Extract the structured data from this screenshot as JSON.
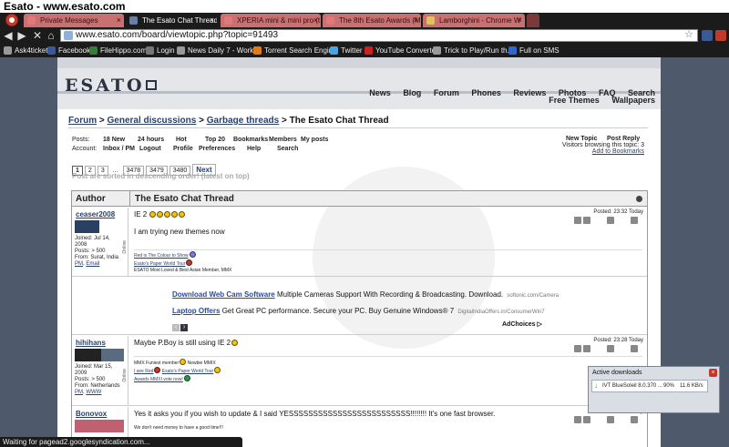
{
  "window": {
    "title": "Esato - www.esato.com"
  },
  "tabs": [
    {
      "label": "Private Messages",
      "color": "#e07a7a"
    },
    {
      "label": "The Esato Chat Thread",
      "color": "#6a7fa0"
    },
    {
      "label": "XPERIA mini & mini pro (t",
      "color": "#e07a7a"
    },
    {
      "label": "The 8th Esato Awards (M",
      "color": "#e07a7a"
    },
    {
      "label": "Lamborghini - Chrome W",
      "color": "#e0c060"
    }
  ],
  "address": {
    "url": "www.esato.com/board/viewtopic.php?topic=91493"
  },
  "bookmarks": [
    {
      "label": "Ask4ticket",
      "color": "#999999"
    },
    {
      "label": "Facebook",
      "color": "#3b5998"
    },
    {
      "label": "FileHippo.com",
      "color": "#3a7a3a"
    },
    {
      "label": "Login",
      "color": "#777777"
    },
    {
      "label": "News Daily 7 - Work...",
      "color": "#999999"
    },
    {
      "label": "Torrent Search Engine",
      "color": "#e07a1a"
    },
    {
      "label": "Twitter",
      "color": "#4aa3df"
    },
    {
      "label": "YouTube Converter",
      "color": "#cc2222"
    },
    {
      "label": "Trick to Play/Run th...",
      "color": "#999999"
    },
    {
      "label": "Full on SMS",
      "color": "#3366cc"
    }
  ],
  "site": {
    "logo": "ESATO",
    "nav": [
      "News",
      "Blog",
      "Forum",
      "Phones",
      "Reviews",
      "Photos",
      "FAQ",
      "Search"
    ],
    "nav2": [
      "Free Themes",
      "Wallpapers"
    ]
  },
  "breadcrumb": {
    "forum": "Forum",
    "general": "General discussions",
    "garbage": "Garbage threads",
    "current": "The Esato Chat Thread",
    "sep": " > "
  },
  "toolbar": {
    "posts_label": "Posts:",
    "posts": [
      "18 New",
      "24 hours",
      "Hot",
      "Top 20",
      "Bookmarks",
      "Members",
      "My posts"
    ],
    "account_label": "Account:",
    "account": [
      "Inbox / PM",
      "Logout",
      "Profile",
      "Preferences",
      "Help",
      "Search"
    ],
    "new_topic": "New Topic",
    "post_reply": "Post Reply",
    "visitors": "Visitors browsing this topic: 3",
    "add_bookmark": "Add to Bookmarks"
  },
  "pager": {
    "pages": [
      "1",
      "2",
      "3",
      "...",
      "3478",
      "3479",
      "3480"
    ],
    "next": "Next",
    "note": "Post are sorted in descending order! (latest on top)"
  },
  "thread": {
    "col_author": "Author",
    "col_title": "The Esato Chat Thread",
    "posts": [
      {
        "user": "ceaser2008",
        "joined": "Joined: Jul 14, 2008",
        "posts": "Posts: > 500",
        "from": "From: Surat, India",
        "pm": "PM",
        "email": "Email",
        "sep": ", ",
        "online": "Online",
        "posted": "Posted: 23:32 Today",
        "text1": "IE 2",
        "text2": "I am trying new themes now",
        "sig1": "Red is The Colour to Show",
        "sig2": "Esato's Paper World Tour",
        "sig3": "ESATO Most Loved & Best Asian Member, MMX"
      },
      {
        "user": "hihihans",
        "joined": "Joined: Mar 15, 2009",
        "posts": "Posts: > 500",
        "from": "From: Netherlands",
        "pm": "PM",
        "www": "WWW",
        "sep": ", ",
        "online": "Online",
        "posted": "Posted: 23:28 Today",
        "text1": "Maybe P.Boy is still using IE 2",
        "sig1": "MMX Funiest member",
        "sig1b": "Newbie MMIX",
        "sig2": "I see Red",
        "sig2b": "Esato's Paper World Tour",
        "sig3": "Awards MMXI vote now!"
      },
      {
        "user": "Bonovox",
        "posted": "Posted: 23:25 Today",
        "text1": "Yes it asks you if you wish to update & I said YESSSSSSSSSSSSSSSSSSSSSSSSS!!!!!!!! It's one fast browser.",
        "sig1": "We don't need money to have a good time!!!"
      }
    ]
  },
  "ads": [
    {
      "title": "Download Web Cam Software",
      "text": "Multiple Cameras Support With Recording & Broadcasting. Download.",
      "url": "softonic.com/Camera"
    },
    {
      "title": "Laptop Offers",
      "text": "Get Great PC performance. Secure your PC. Buy Genuine Windows® 7",
      "url": "DigitalIndiaOffers.in/ConsumerWin7"
    }
  ],
  "adchoices": "AdChoices",
  "downloads": {
    "title": "Active downloads",
    "item": "IVT BlueSoleil 8.0.370 ...",
    "percent": "90%",
    "speed": "11.6 KB/s"
  },
  "status": "Waiting for pagead2.googlesyndication.com..."
}
